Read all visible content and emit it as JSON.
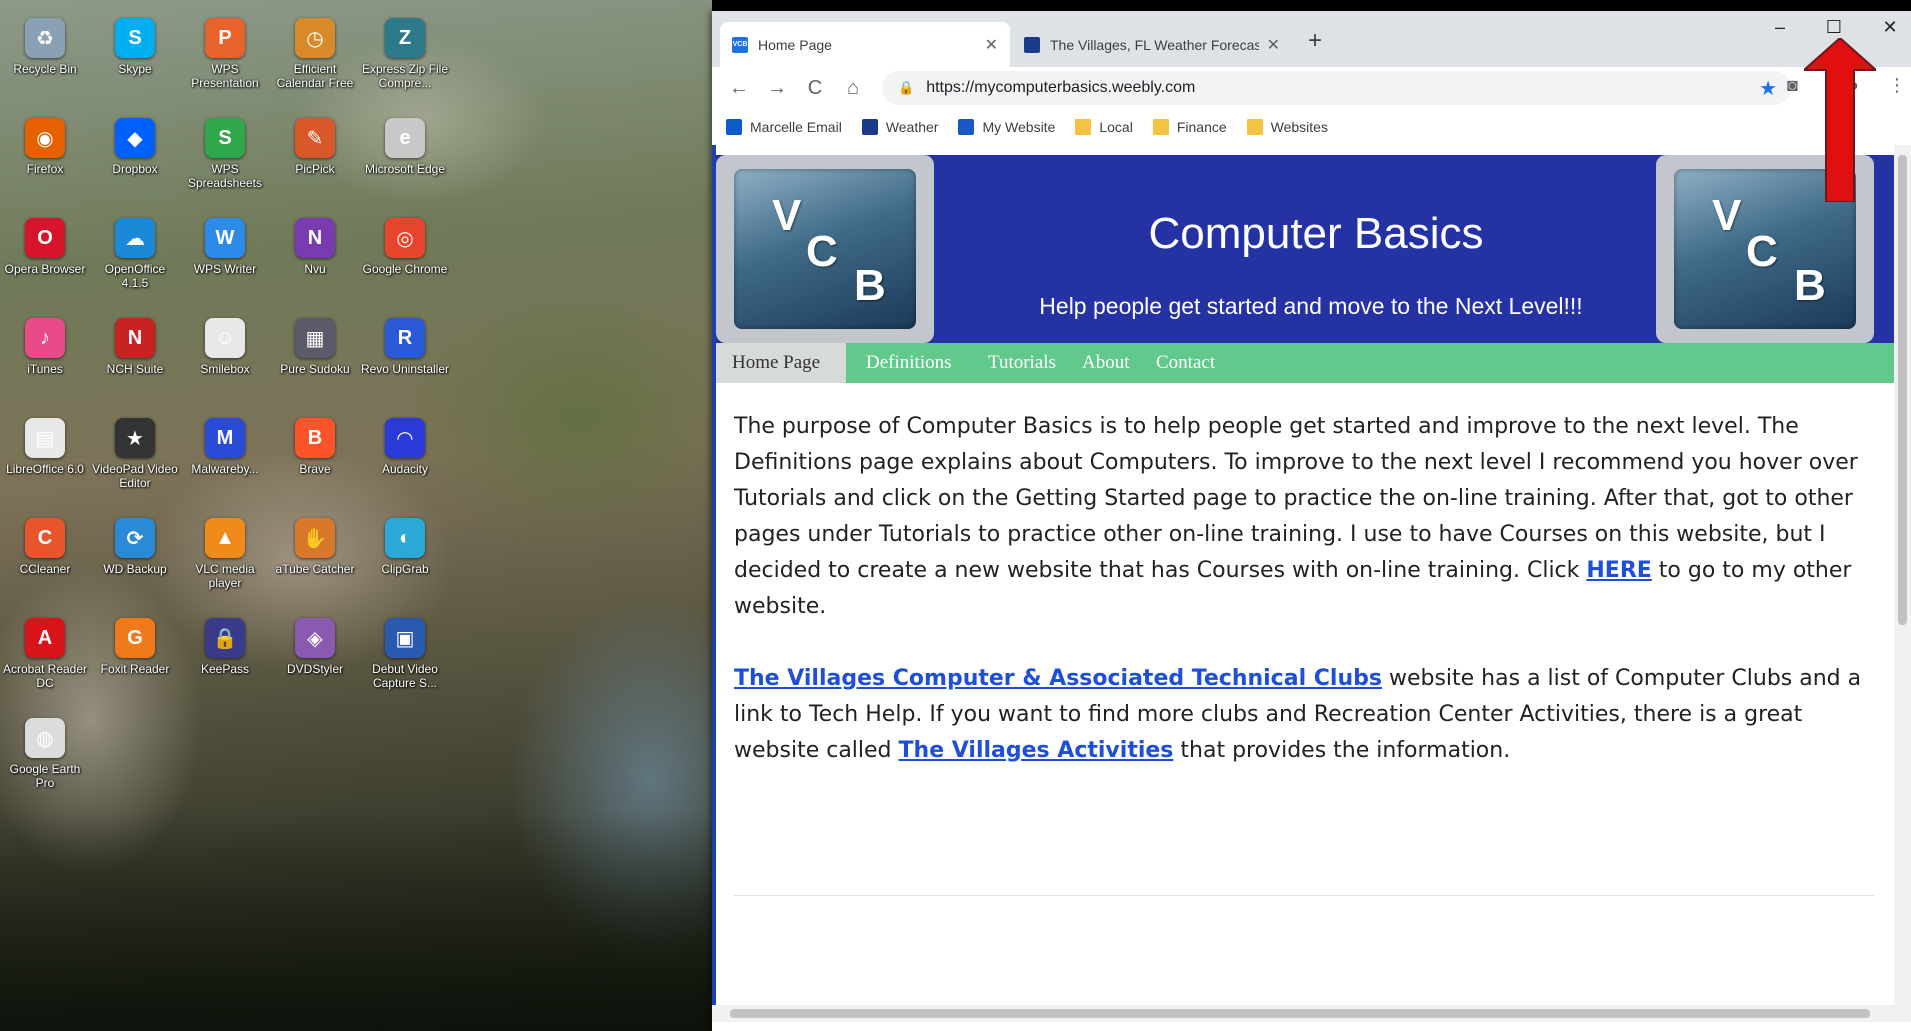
{
  "desktop": {
    "icons": [
      {
        "label": "Recycle Bin",
        "icon": "recycle-bin-icon",
        "color": "#8aa0b4",
        "glyph": "♻"
      },
      {
        "label": "Skype",
        "icon": "skype-icon",
        "color": "#00aff0",
        "glyph": "S"
      },
      {
        "label": "WPS Presentation",
        "icon": "wps-presentation-icon",
        "color": "#e8622c",
        "glyph": "P"
      },
      {
        "label": "Efficient Calendar Free",
        "icon": "calendar-icon",
        "color": "#d88a2a",
        "glyph": "◷"
      },
      {
        "label": "Express Zip File Compre...",
        "icon": "zip-icon",
        "color": "#2c7a8a",
        "glyph": "Z"
      },
      {
        "label": "Firefox",
        "icon": "firefox-icon",
        "color": "#e66000",
        "glyph": "◉"
      },
      {
        "label": "Dropbox",
        "icon": "dropbox-icon",
        "color": "#0061ff",
        "glyph": "◆"
      },
      {
        "label": "WPS Spreadsheets",
        "icon": "wps-spreadsheets-icon",
        "color": "#2ea84a",
        "glyph": "S"
      },
      {
        "label": "PicPick",
        "icon": "picpick-icon",
        "color": "#d8582a",
        "glyph": "✎"
      },
      {
        "label": "Microsoft Edge",
        "icon": "edge-icon",
        "color": "#c8c8c8",
        "glyph": "e"
      },
      {
        "label": "Opera Browser",
        "icon": "opera-icon",
        "color": "#d8142a",
        "glyph": "O"
      },
      {
        "label": "OpenOffice 4.1.5",
        "icon": "openoffice-icon",
        "color": "#1a8ad8",
        "glyph": "☁"
      },
      {
        "label": "WPS Writer",
        "icon": "wps-writer-icon",
        "color": "#2c8ae8",
        "glyph": "W"
      },
      {
        "label": "Nvu",
        "icon": "nvu-icon",
        "color": "#7a3ab0",
        "glyph": "N"
      },
      {
        "label": "Google Chrome",
        "icon": "chrome-icon",
        "color": "#e8452c",
        "glyph": "◎"
      },
      {
        "label": "iTunes",
        "icon": "itunes-icon",
        "color": "#e84a8a",
        "glyph": "♪"
      },
      {
        "label": "NCH Suite",
        "icon": "nch-suite-icon",
        "color": "#c82222",
        "glyph": "N"
      },
      {
        "label": "Smilebox",
        "icon": "smilebox-icon",
        "color": "#e8e8e8",
        "glyph": "☺"
      },
      {
        "label": "Pure Sudoku",
        "icon": "sudoku-icon",
        "color": "#5a5a6a",
        "glyph": "▦"
      },
      {
        "label": "Revo Uninstaller",
        "icon": "revo-icon",
        "color": "#2a5ad8",
        "glyph": "R"
      },
      {
        "label": "LibreOffice 6.0",
        "icon": "libreoffice-icon",
        "color": "#e8e8e8",
        "glyph": "▤"
      },
      {
        "label": "VideoPad Video Editor",
        "icon": "videopad-icon",
        "color": "#333333",
        "glyph": "★"
      },
      {
        "label": "Malwareby...",
        "icon": "malwarebytes-icon",
        "color": "#2a4ad8",
        "glyph": "M"
      },
      {
        "label": "Brave",
        "icon": "brave-icon",
        "color": "#fb542b",
        "glyph": "B"
      },
      {
        "label": "Audacity",
        "icon": "audacity-icon",
        "color": "#2a3ad8",
        "glyph": "◠"
      },
      {
        "label": "CCleaner",
        "icon": "ccleaner-icon",
        "color": "#e8542c",
        "glyph": "C"
      },
      {
        "label": "WD Backup",
        "icon": "wd-backup-icon",
        "color": "#2a8ad8",
        "glyph": "⟳"
      },
      {
        "label": "VLC media player",
        "icon": "vlc-icon",
        "color": "#f08a1a",
        "glyph": "▲"
      },
      {
        "label": "aTube Catcher",
        "icon": "atube-catcher-icon",
        "color": "#d8782a",
        "glyph": "✋"
      },
      {
        "label": "ClipGrab",
        "icon": "clipgrab-icon",
        "color": "#2aa8d8",
        "glyph": "◐"
      },
      {
        "label": "Acrobat Reader DC",
        "icon": "acrobat-icon",
        "color": "#d8141a",
        "glyph": "A"
      },
      {
        "label": "Foxit Reader",
        "icon": "foxit-icon",
        "color": "#f07a1a",
        "glyph": "G"
      },
      {
        "label": "KeePass",
        "icon": "keepass-icon",
        "color": "#3a3a8a",
        "glyph": "🔒"
      },
      {
        "label": "DVDStyler",
        "icon": "dvdstyler-icon",
        "color": "#8a5ab0",
        "glyph": "◈"
      },
      {
        "label": "Debut Video Capture S...",
        "icon": "debut-icon",
        "color": "#2a5ab0",
        "glyph": "▣"
      },
      {
        "label": "Google Earth Pro",
        "icon": "google-earth-icon",
        "color": "#dcdcdc",
        "glyph": "◍"
      }
    ]
  },
  "browser": {
    "tabs": [
      {
        "title": "Home Page",
        "favicon": "vcb-favicon-icon"
      },
      {
        "title": "The Villages, FL Weather Forecast",
        "favicon": "weather-favicon-icon"
      }
    ],
    "new_tab": "+",
    "window_controls": {
      "minimize": "–",
      "maximize": "☐",
      "close": "✕"
    },
    "toolbar": {
      "back": "←",
      "forward": "→",
      "reload": "C",
      "home": "⌂",
      "url": "https://mycomputerbasics.weebly.com",
      "lock": "🔒",
      "star": "★"
    },
    "bookmarks": [
      {
        "label": "Marcelle Email",
        "type": "site",
        "color": "#0a5cc8"
      },
      {
        "label": "Weather",
        "type": "site",
        "color": "#1a3a8a"
      },
      {
        "label": "My Website",
        "type": "site",
        "color": "#1a56c4"
      },
      {
        "label": "Local",
        "type": "folder"
      },
      {
        "label": "Finance",
        "type": "folder"
      },
      {
        "label": "Websites",
        "type": "folder"
      }
    ]
  },
  "site": {
    "logo": {
      "v": "V",
      "c": "C",
      "b": "B"
    },
    "title": "Computer Basics",
    "subtitle": "Help people get started and move to the Next Level!!!",
    "nav": [
      "Home Page",
      "Definitions",
      "Tutorials",
      "About",
      "Contact"
    ],
    "para1_text": "The purpose of Computer Basics is to help people get started and improve to the next level. The Definitions page explains about Computers.  To improve to the next level I recommend you hover over Tutorials and click on the Getting Started page to practice the on-line training.  After that, got to other pages under Tutorials to practice other on-line training.  I use to have Courses on this website, but I decided to create a new website that has Courses with on-line training.  Click ",
    "para1_link": "HERE",
    "para1_after": " to go to my other website.",
    "para2_link1": "The Villages Computer & Associated Technical Clubs",
    "para2_mid": " website has a list of Computer Clubs and a link to Tech Help.  If you want to find more clubs and Recreation Center Activities, there is a great website called ",
    "para2_link2": "The Villages Activities",
    "para2_after": " that provides the information."
  },
  "colors": {
    "hero": "#2432a3",
    "navbar": "#62c98c",
    "link": "#1d4fd8",
    "annotation_arrow": "#e01010"
  }
}
